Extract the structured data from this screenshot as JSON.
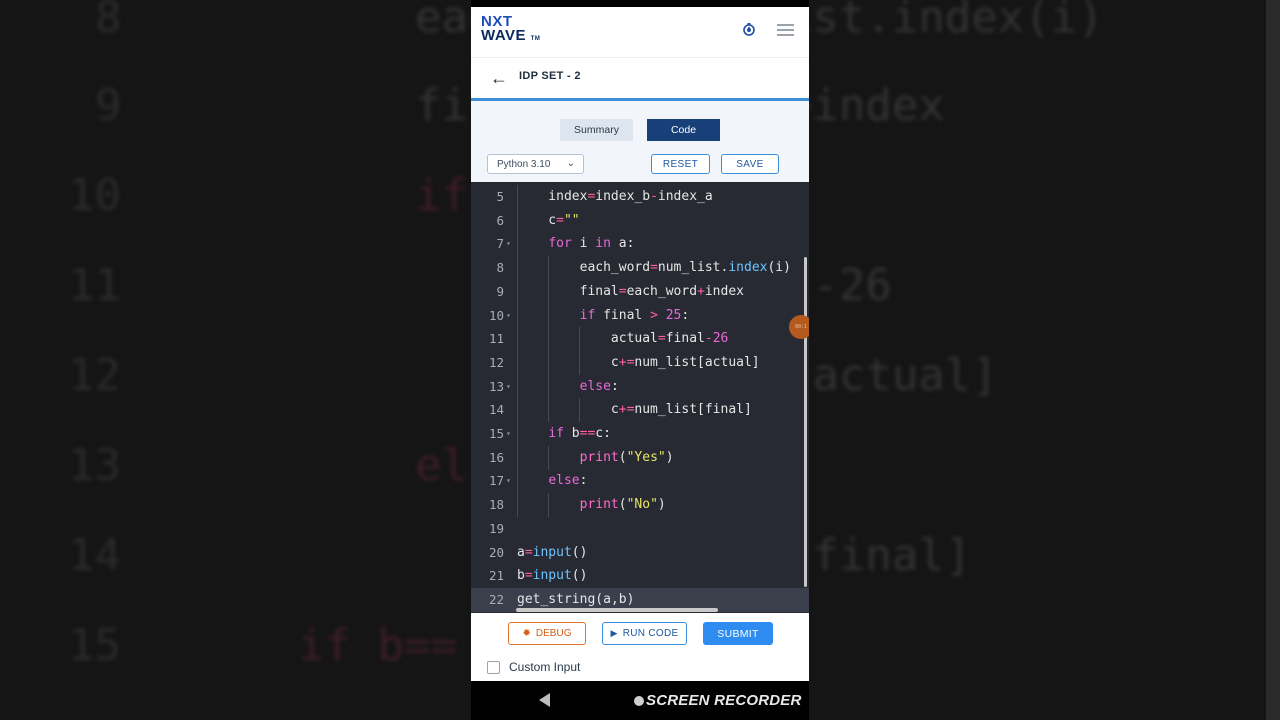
{
  "app": {
    "logo_line1": "NXT",
    "logo_line2": "WAVE",
    "logo_tm": "TM",
    "set_title": "IDP SET - 2"
  },
  "tabs": {
    "summary": "Summary",
    "code": "Code",
    "active": "Code"
  },
  "toolbar": {
    "language": "Python 3.10",
    "reset": "RESET",
    "save": "SAVE"
  },
  "editor": {
    "active_line": 22,
    "lines": [
      {
        "n": "5",
        "text": "    index=index_b-index_a"
      },
      {
        "n": "6",
        "text": "    c=\"\""
      },
      {
        "n": "7",
        "text": "    for i in a:"
      },
      {
        "n": "8",
        "text": "        each_word=num_list.index(i)"
      },
      {
        "n": "9",
        "text": "        final=each_word+index"
      },
      {
        "n": "10",
        "text": "        if final > 25:"
      },
      {
        "n": "11",
        "text": "            actual=final-26"
      },
      {
        "n": "12",
        "text": "            c+=num_list[actual]"
      },
      {
        "n": "13",
        "text": "        else:"
      },
      {
        "n": "14",
        "text": "            c+=num_list[final]"
      },
      {
        "n": "15",
        "text": "    if b==c:"
      },
      {
        "n": "16",
        "text": "        print(\"Yes\")"
      },
      {
        "n": "17",
        "text": "    else:"
      },
      {
        "n": "18",
        "text": "        print(\"No\")"
      },
      {
        "n": "19",
        "text": ""
      },
      {
        "n": "20",
        "text": "a=input()"
      },
      {
        "n": "21",
        "text": "b=input()"
      },
      {
        "n": "22",
        "text": "get_string(a,b)"
      }
    ]
  },
  "footer": {
    "debug": "DEBUG",
    "run_code": "RUN CODE",
    "submit": "SUBMIT",
    "custom_input": "Custom Input"
  },
  "overlay": {
    "watermark": "SCREEN RECORDER"
  },
  "background": {
    "lines": [
      {
        "n": "8",
        "text": "eac         _list.index(i)"
      },
      {
        "n": "9",
        "text": "fi          rd+index"
      },
      {
        "n": "10",
        "text": "if          :"
      },
      {
        "n": "11",
        "text": "            nal-26"
      },
      {
        "n": "12",
        "text": "            st[actual]"
      },
      {
        "n": "13",
        "text": "el"
      },
      {
        "n": "14",
        "text": "            st[final]"
      },
      {
        "n": "15",
        "text": "if b=="
      }
    ]
  },
  "colors": {
    "accent": "#3d8ed8",
    "code_tab": "#173f78",
    "submit": "#2e8bf0",
    "debug": "#e0742e",
    "editor_bg": "#272a32"
  }
}
